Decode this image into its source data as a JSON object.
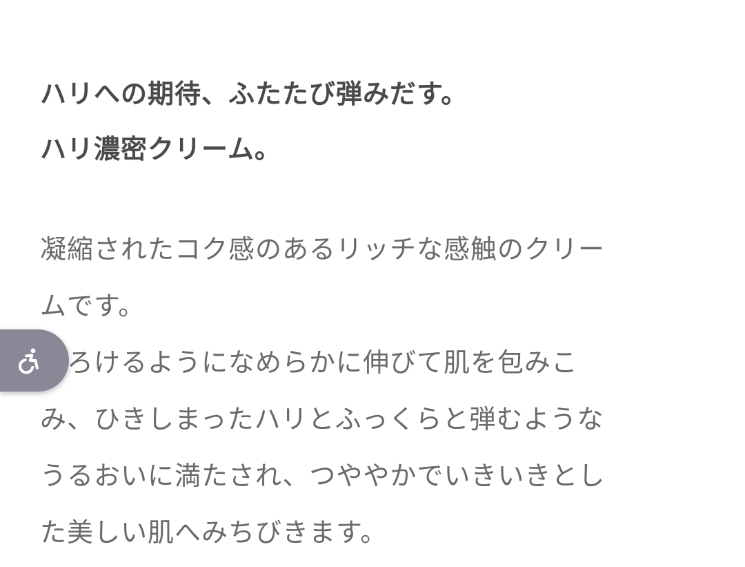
{
  "headline": {
    "line1": "ハリへの期待、ふたたび弾みだす。",
    "line2": "ハリ濃密クリーム。"
  },
  "description": {
    "lines": [
      "凝縮されたコク感のあるリッチな感触のクリー",
      "ムです。",
      "とろけるようになめらかに伸びて肌を包みこ",
      "み、ひきしまったハリとふっくらと弾むような",
      "うるおいに満たされ、つややかでいきいきとし",
      "た美しい肌へみちびきます。"
    ]
  },
  "accessibility_widget": {
    "icon": "wheelchair-icon",
    "color": "#8a8896"
  }
}
